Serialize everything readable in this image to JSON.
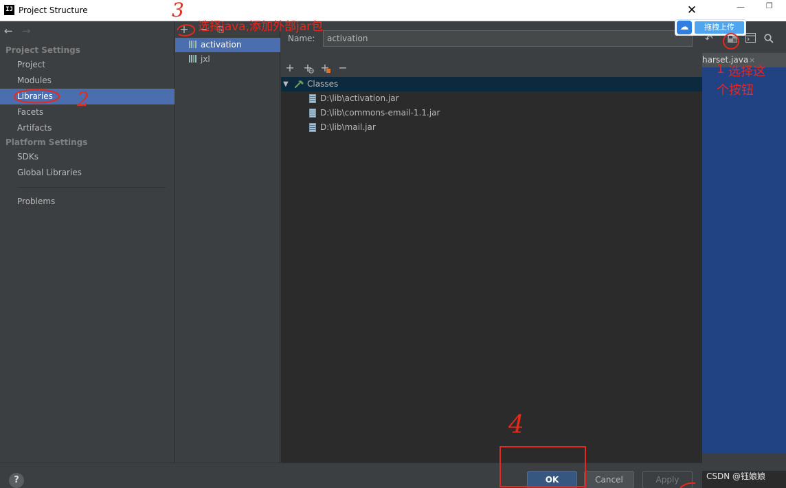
{
  "window": {
    "app_icon": "IJ",
    "title": "Project Structure",
    "close_icon": "close-icon"
  },
  "nav": {
    "back_icon": "←",
    "forward_icon": "→",
    "project_settings_title": "Project Settings",
    "project_settings_items": [
      "Project",
      "Modules",
      "Libraries",
      "Facets",
      "Artifacts"
    ],
    "selected": "Libraries",
    "platform_settings_title": "Platform Settings",
    "platform_settings_items": [
      "SDKs",
      "Global Libraries"
    ],
    "problems": "Problems"
  },
  "libraries": {
    "toolbar": [
      "+",
      "−",
      "⎘"
    ],
    "items": [
      "activation",
      "jxl"
    ],
    "selected": "activation"
  },
  "details": {
    "name_label": "Name:",
    "name_value": "activation",
    "toolbar": [
      "+",
      "+",
      "+",
      "−"
    ],
    "tree_root": "Classes",
    "entries": [
      "D:\\lib\\activation.jar",
      "D:\\lib\\commons-email-1.1.jar",
      "D:\\lib\\mail.jar"
    ]
  },
  "footer": {
    "help": "?",
    "ok": "OK",
    "cancel": "Cancel",
    "apply": "Apply"
  },
  "ide": {
    "tab_label": "harset.java",
    "tab_close": "×",
    "minimize": "—",
    "maximize": "❐"
  },
  "overlay": {
    "upload_button": "拖拽上传"
  },
  "watermark": "CSDN @钰娘娘",
  "annotations": {
    "step1_num": "1",
    "step1_text_line1": "选择这",
    "step1_text_line2": "个按钮",
    "step2_num": "2",
    "step3_num": "3",
    "step3_text": "选择java,添加外部jar包",
    "step4_num": "4"
  },
  "colors": {
    "selection": "#4b6eaf",
    "annotation_red": "#e8281c",
    "ok_button": "#365880",
    "editor_bg": "#214283"
  }
}
